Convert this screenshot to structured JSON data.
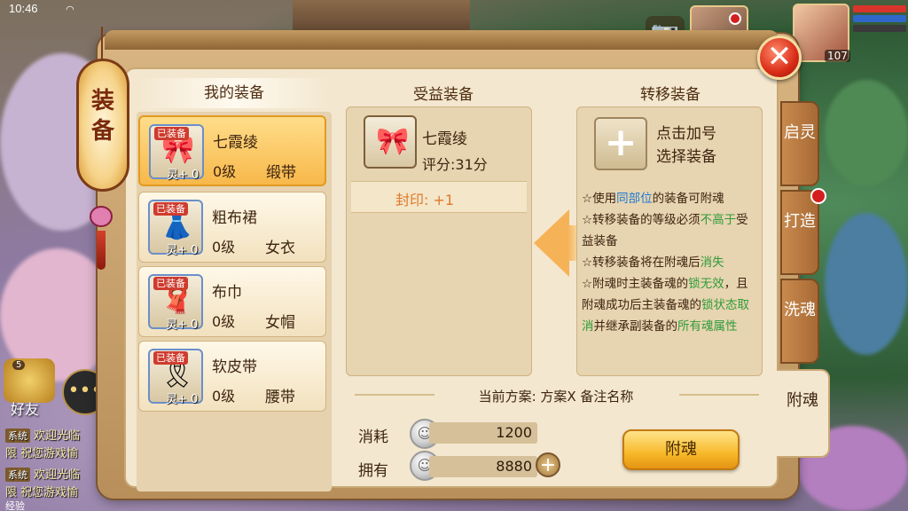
{
  "status_bar": {
    "time": "10:46"
  },
  "hud": {
    "level": "107"
  },
  "panel": {
    "lantern_title_1": "装",
    "lantern_title_2": "备"
  },
  "my_equipment": {
    "header": "我的装备",
    "items": [
      {
        "name": "七霞绫",
        "level": "0级",
        "type": "缎带",
        "equipped": "已装备",
        "soul": "灵+ 0",
        "glyph": "🎀",
        "selected": true
      },
      {
        "name": "粗布裙",
        "level": "0级",
        "type": "女衣",
        "equipped": "已装备",
        "soul": "灵+ 0",
        "glyph": "👗",
        "selected": false
      },
      {
        "name": "布巾",
        "level": "0级",
        "type": "女帽",
        "equipped": "已装备",
        "soul": "灵+ 0",
        "glyph": "🧣",
        "selected": false
      },
      {
        "name": "软皮带",
        "level": "0级",
        "type": "腰带",
        "equipped": "已装备",
        "soul": "灵+ 0",
        "glyph": "🎗",
        "selected": false
      }
    ]
  },
  "beneficiary": {
    "header": "受益装备",
    "name": "七霞绫",
    "score": "评分:31分",
    "seal": "封印: +1"
  },
  "transfer": {
    "header": "转移装备",
    "hint_line1": "点击加号",
    "hint_line2": "选择装备",
    "rules": {
      "r1_a": "☆使用",
      "r1_b": "同部位",
      "r1_c": "的装备可附魂",
      "r2_a": "☆转移装备的等级必须",
      "r2_b": "不高于",
      "r2_c": "受益装备",
      "r3_a": "☆转移装备将在附魂后",
      "r3_b": "消失",
      "r4_a": "☆附魂时主装备魂的",
      "r4_b": "锁无效",
      "r4_c": "，且附魂成功后主装备魂的",
      "r4_d": "锁状态取消",
      "r4_e": "并继承副装备的",
      "r4_f": "所有魂属性"
    }
  },
  "plan": {
    "text": "当前方案: 方案X  备注名称"
  },
  "cost": {
    "consume_label": "消耗",
    "consume_value": "1200",
    "own_label": "拥有",
    "own_value": "8880"
  },
  "buttons": {
    "attach_soul": "附魂",
    "close": "✕",
    "plus": "+"
  },
  "tabs": [
    {
      "label": "启灵"
    },
    {
      "label": "打造"
    },
    {
      "label": "洗魂"
    },
    {
      "label": "附魂"
    }
  ],
  "left_hud": {
    "friend_badge": "5",
    "friend_label": "好友",
    "chat": [
      {
        "tag": "系统",
        "text": "欢迎光临"
      },
      {
        "tag": "",
        "text": "限  祝您游戏愉"
      },
      {
        "tag": "系统",
        "text": "欢迎光临"
      },
      {
        "tag": "",
        "text": "限  祝您游戏愉"
      }
    ],
    "exp_label": "经验"
  }
}
